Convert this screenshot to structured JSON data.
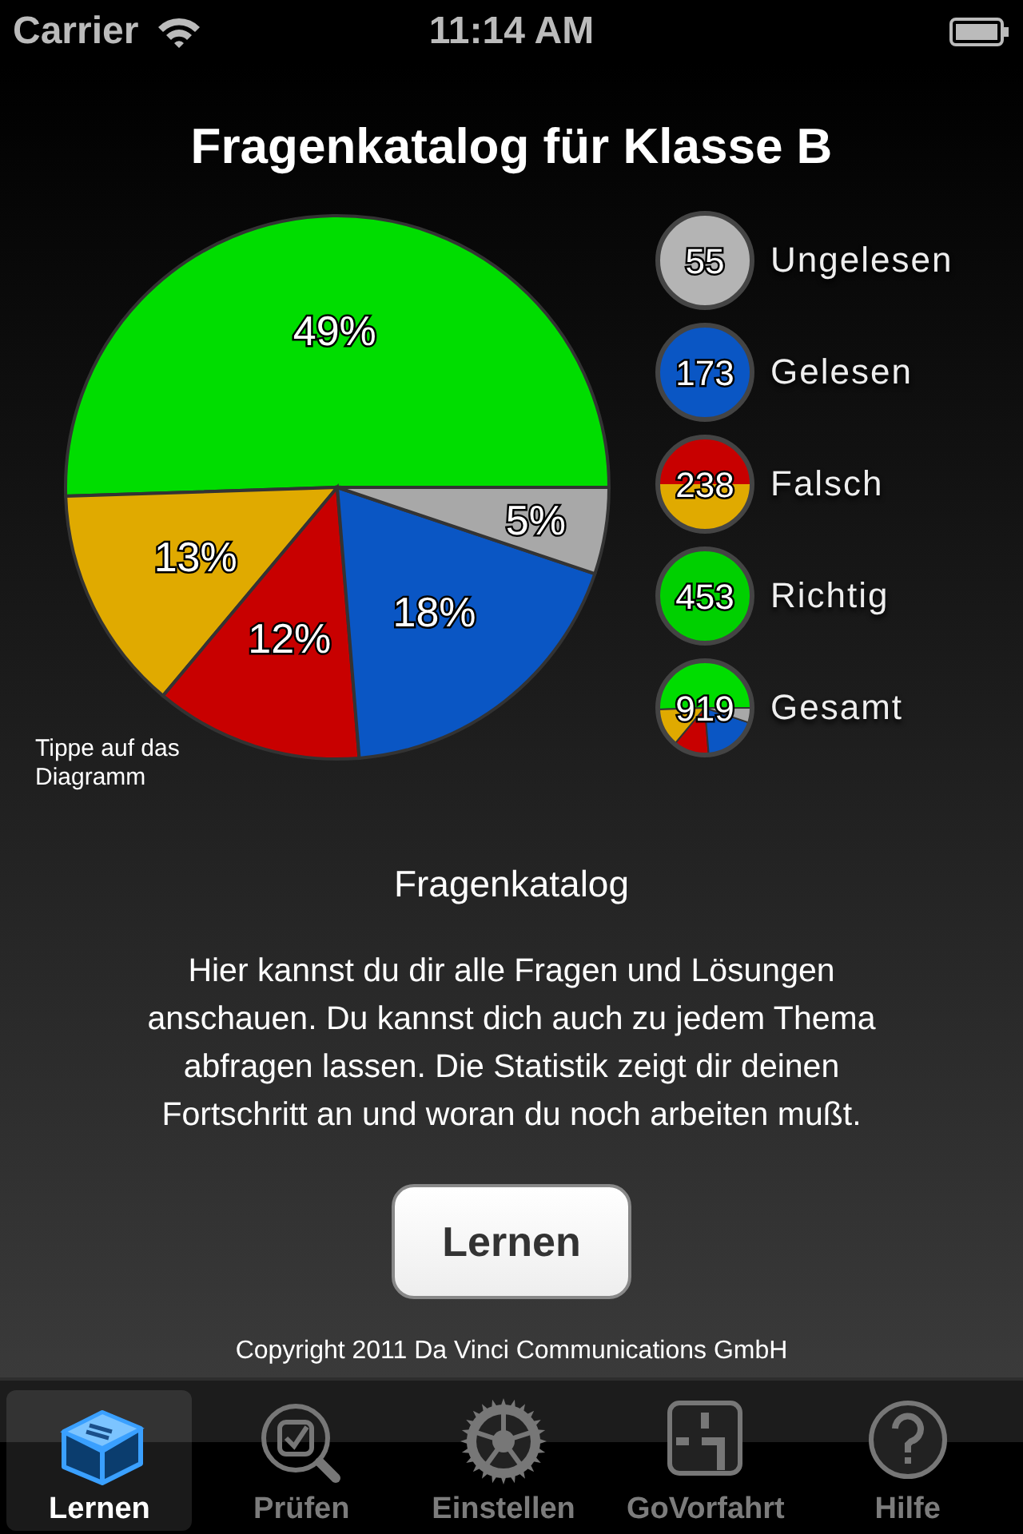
{
  "status_bar": {
    "carrier": "Carrier",
    "time": "11:14 AM"
  },
  "title": "Fragenkatalog für Klasse B",
  "chart": {
    "chart_data": {
      "type": "pie",
      "values": [
        5,
        18,
        12,
        13,
        49
      ],
      "value_labels": [
        "5%",
        "18%",
        "12%",
        "13%",
        "49%"
      ],
      "colors": [
        "#a8a8a8",
        "#0a56c4",
        "#c80000",
        "#e0aa00",
        "#00dd00"
      ]
    },
    "hint": "Tippe auf das Diagramm"
  },
  "legend": [
    {
      "count": "55",
      "label": "Ungelesen",
      "kind": "solid",
      "color": "#b4b4b4"
    },
    {
      "count": "173",
      "label": "Gelesen",
      "kind": "solid",
      "color": "#0a56c4"
    },
    {
      "count": "238",
      "label": "Falsch",
      "kind": "split"
    },
    {
      "count": "453",
      "label": "Richtig",
      "kind": "solid",
      "color": "#00d000"
    },
    {
      "count": "919",
      "label": "Gesamt",
      "kind": "pie"
    }
  ],
  "section": {
    "heading": "Fragenkatalog",
    "text": "Hier kannst du dir alle Fragen und Lösungen anschauen. Du kannst dich auch zu jedem Thema abfragen lassen. Die Statistik zeigt dir deinen Fortschritt an und woran du noch arbeiten mußt.",
    "button": "Lernen"
  },
  "copyright": "Copyright 2011 Da Vinci Communications GmbH",
  "tabs": [
    {
      "label": "Lernen",
      "selected": true
    },
    {
      "label": "Prüfen",
      "selected": false
    },
    {
      "label": "Einstellen",
      "selected": false
    },
    {
      "label": "GoVorfahrt",
      "selected": false
    },
    {
      "label": "Hilfe",
      "selected": false
    }
  ]
}
